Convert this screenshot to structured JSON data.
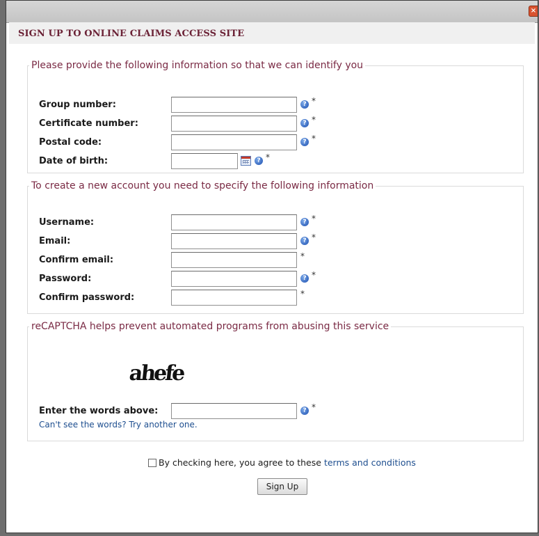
{
  "window": {
    "close_glyph": "×"
  },
  "heading": "SIGN UP TO ONLINE CLAIMS ACCESS SITE",
  "identify": {
    "legend": "Please provide the following information so that we can identify you",
    "fields": [
      {
        "label": "Group number:",
        "value": ""
      },
      {
        "label": "Certificate number:",
        "value": ""
      },
      {
        "label": "Postal code:",
        "value": ""
      },
      {
        "label": "Date of birth:",
        "value": ""
      }
    ]
  },
  "account": {
    "legend": "To create a new account you need to specify the following information",
    "fields": [
      {
        "label": "Username:",
        "value": ""
      },
      {
        "label": "Email:",
        "value": ""
      },
      {
        "label": "Confirm email:",
        "value": ""
      },
      {
        "label": "Password:",
        "value": ""
      },
      {
        "label": "Confirm password:",
        "value": ""
      }
    ]
  },
  "captcha": {
    "legend": "reCAPTCHA helps prevent automated programs from abusing this service",
    "image_text": "ahefe",
    "label": "Enter the words above:",
    "value": "",
    "retry_link": "Can't see the words? Try another one."
  },
  "common": {
    "required_mark": "*",
    "help_glyph": "?"
  },
  "agreement": {
    "checked": false,
    "text": "By checking here, you agree to these ",
    "link": "terms and conditions"
  },
  "submit_label": "Sign Up",
  "colors": {
    "heading": "#6b2236",
    "legend": "#7a2a44",
    "link": "#1d4e8f",
    "help_icon": "#1c4fb0"
  }
}
